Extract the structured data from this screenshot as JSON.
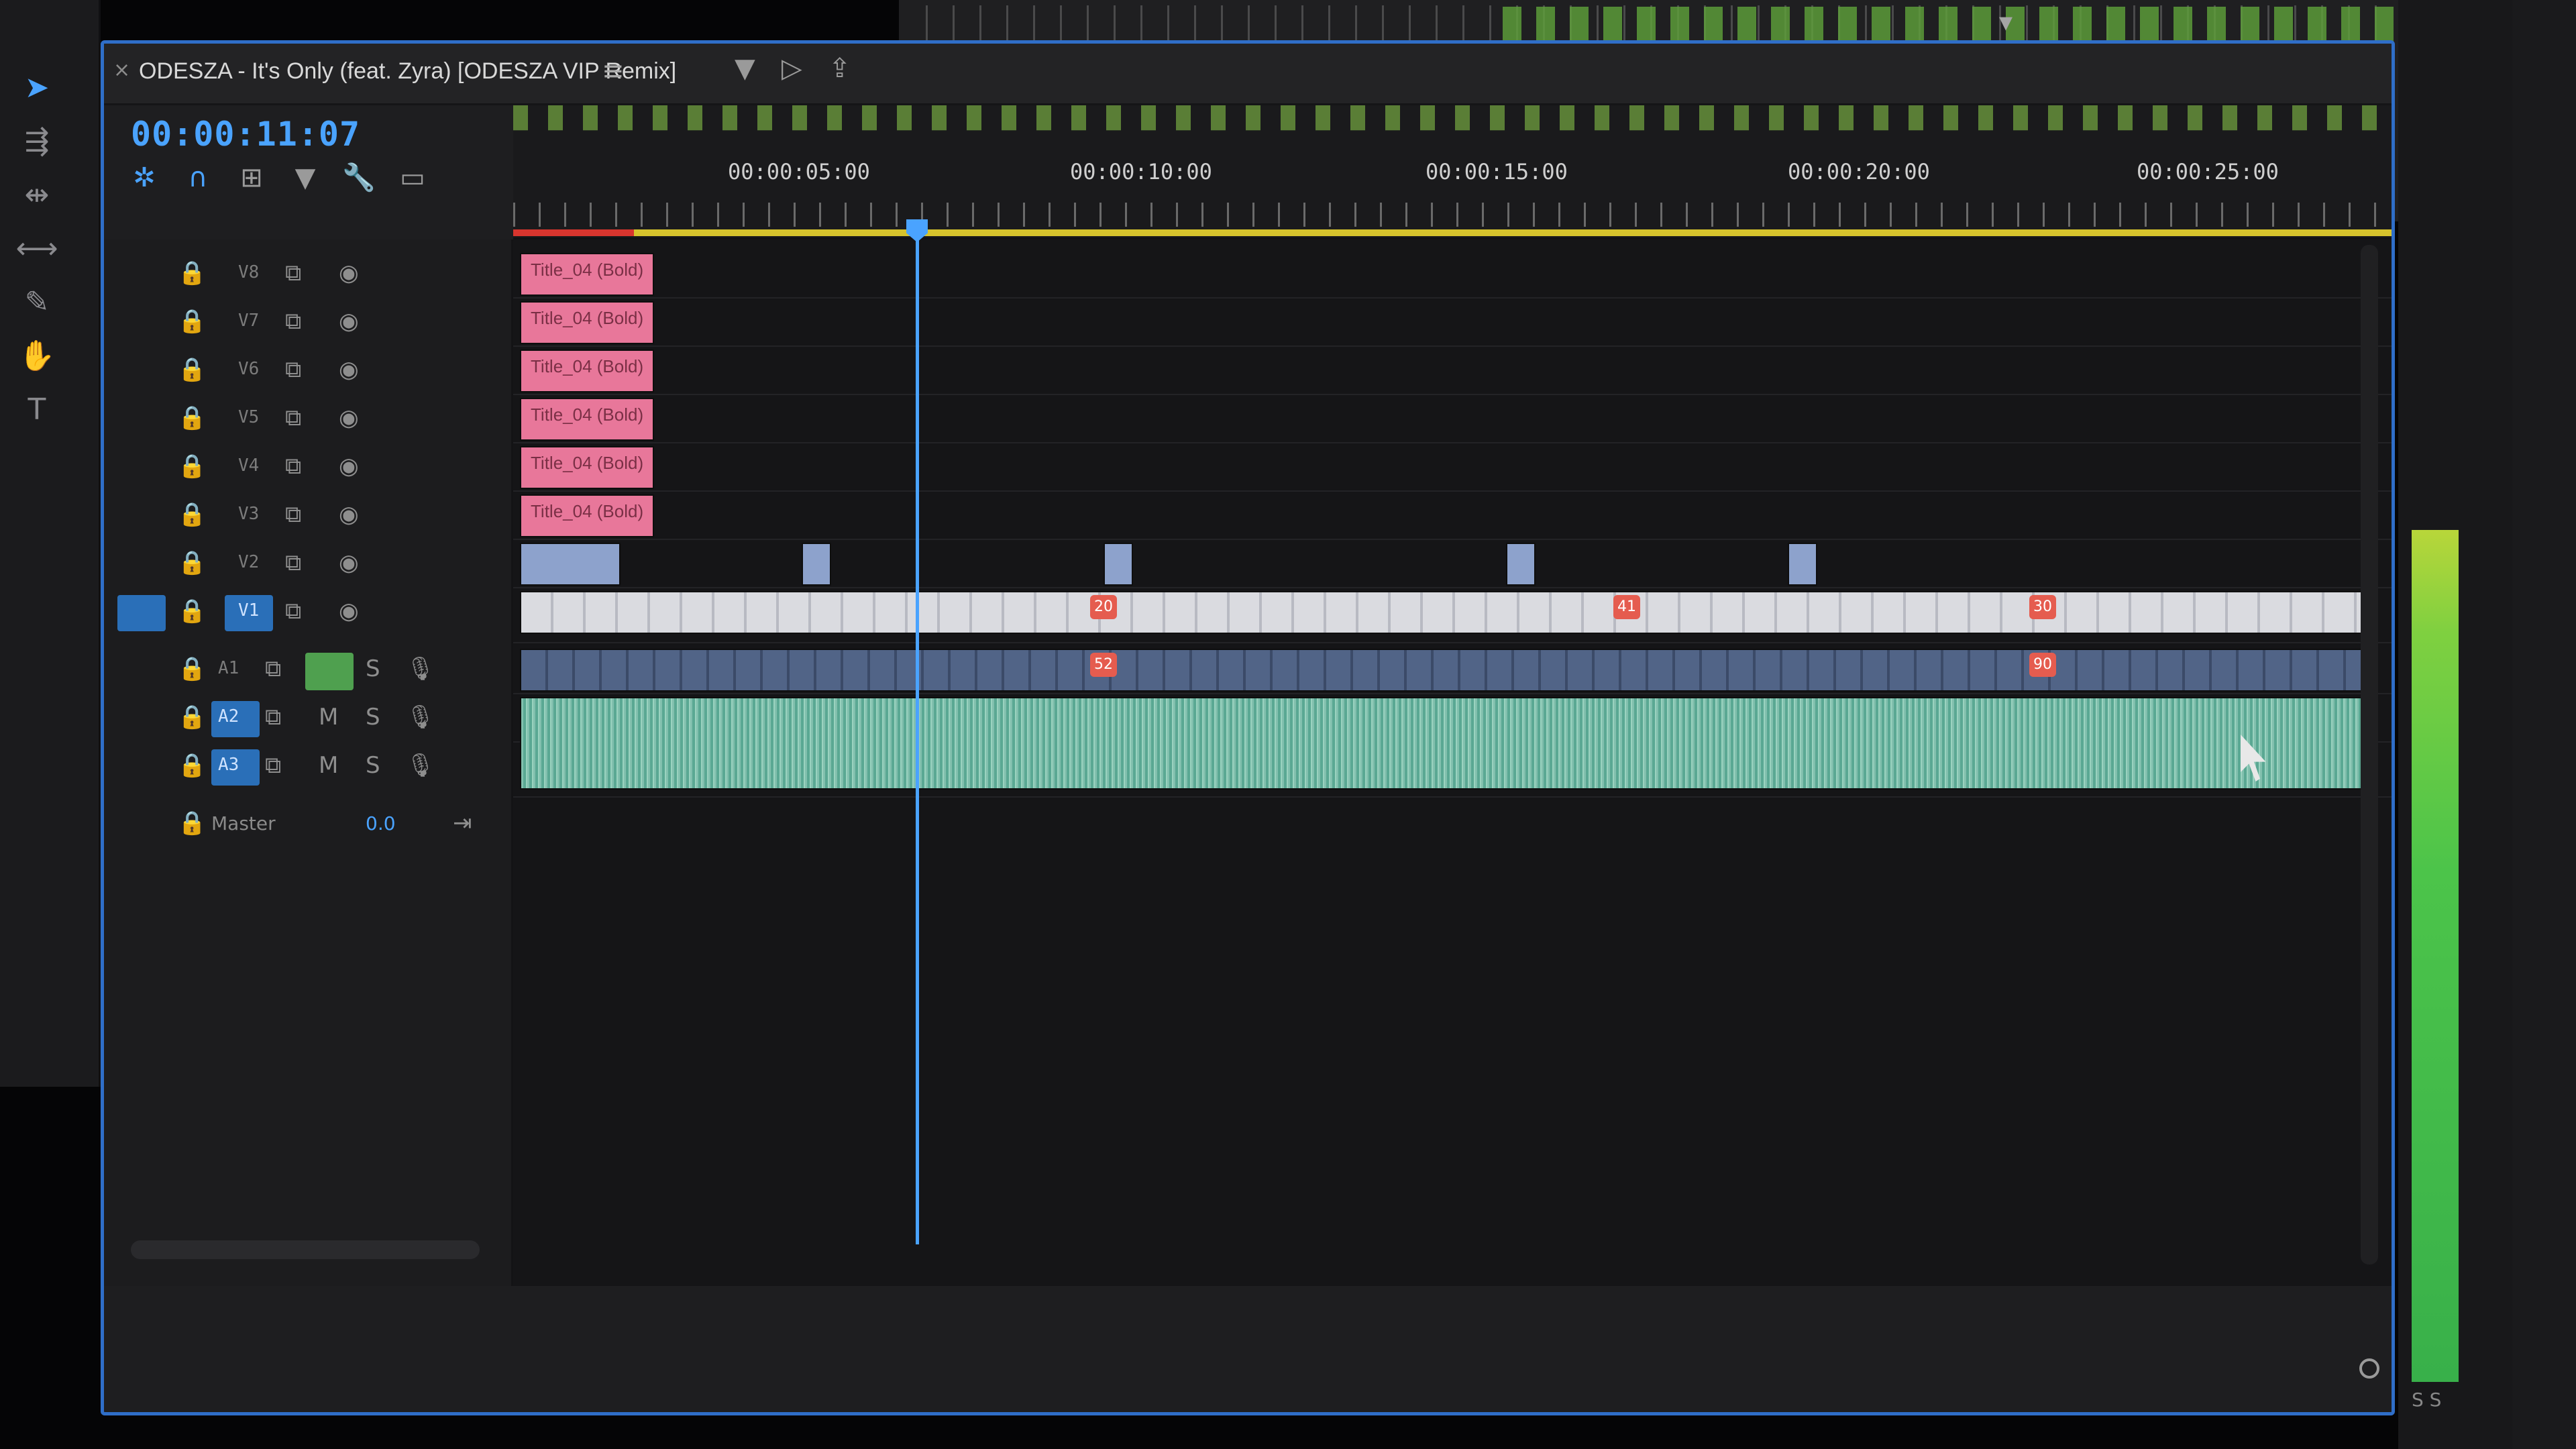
{
  "sequence": {
    "title": "ODESZA - It's Only (feat. Zyra) [ODESZA VIP Remix]",
    "timecode": "00:00:11:07"
  },
  "ruler": {
    "labels": [
      "00:00:05:00",
      "00:00:10:00",
      "00:00:15:00",
      "00:00:20:00",
      "00:00:25:00"
    ]
  },
  "tracks": {
    "video": [
      "V8",
      "V7",
      "V6",
      "V5",
      "V4",
      "V3",
      "V2",
      "V1"
    ],
    "audio": [
      "A1",
      "A2",
      "A3"
    ],
    "master": {
      "label": "Master",
      "value": "0.0"
    }
  },
  "clips": {
    "title_clip_label": "Title_04 (Bold)",
    "fx_badges": [
      "20",
      "52",
      "41",
      "30",
      "90"
    ]
  },
  "icons": {
    "close": "close-icon",
    "menu": "hamburger-menu-icon",
    "filter": "filter-icon",
    "export": "export-icon",
    "lock": "lock-icon",
    "eye": "eye-icon",
    "sync": "sync-icon",
    "mute": "mute-icon",
    "solo": "solo-icon",
    "mic": "microphone-icon",
    "play": "play-icon",
    "stop": "stop-icon"
  },
  "colors": {
    "accent": "#4aa3ff",
    "title_clip": "#e8779a",
    "audio_clip": "#5fb39a",
    "work_area": "#d6c32c",
    "meter": "#4cc44a"
  }
}
